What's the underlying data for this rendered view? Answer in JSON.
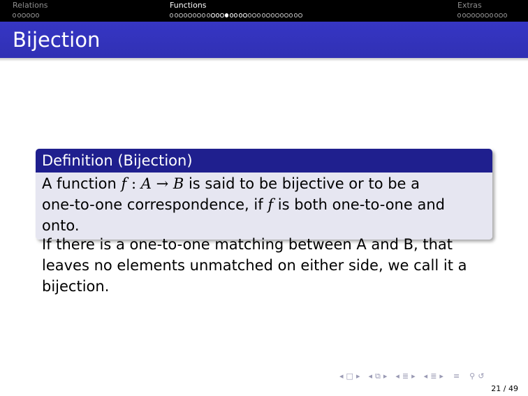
{
  "nav": {
    "sections": [
      {
        "title": "Relations",
        "dots": 6,
        "active": false,
        "current_index": -1
      },
      {
        "title": "Functions",
        "dots": 29,
        "active": true,
        "current_index": 12,
        "frame_dots": [
          9,
          10,
          11,
          12,
          13,
          14,
          15,
          16
        ]
      },
      {
        "title": "Extras",
        "dots": 11,
        "active": false,
        "current_index": -1
      }
    ]
  },
  "frame": {
    "title": "Bijection"
  },
  "definition": {
    "title": "Definition (Bijection)",
    "line1_prefix": "A function ",
    "f": "f",
    "colon": " : ",
    "A": "A",
    "arrow": " → ",
    "B": "B",
    "line1_suffix": " is said to be bijective or to be a",
    "line2_prefix": "one-to-one correspondence, if ",
    "f2": "f",
    "line2_suffix": " is both one-to-one and onto."
  },
  "body": {
    "text": "If there is a one-to-one matching between A and B, that leaves no elements unmatched on either side, we call it a bijection."
  },
  "footer": {
    "page_number": "21 / 49",
    "icons": [
      "frame-back-icon",
      "frame-icon",
      "frame-forward-icon",
      "subsection-back-icon",
      "subsection-icon",
      "subsection-forward-icon",
      "section-back-icon",
      "section-icon",
      "section-forward-icon",
      "slide-back-icon",
      "slide-icon",
      "slide-forward-icon",
      "align-icon",
      "search-icon",
      "undo-icon"
    ]
  },
  "colors": {
    "navbar": "#000000",
    "titlebar": "#3333b3",
    "block_title": "#1f1f8e",
    "block_body": "#e6e6f1"
  }
}
